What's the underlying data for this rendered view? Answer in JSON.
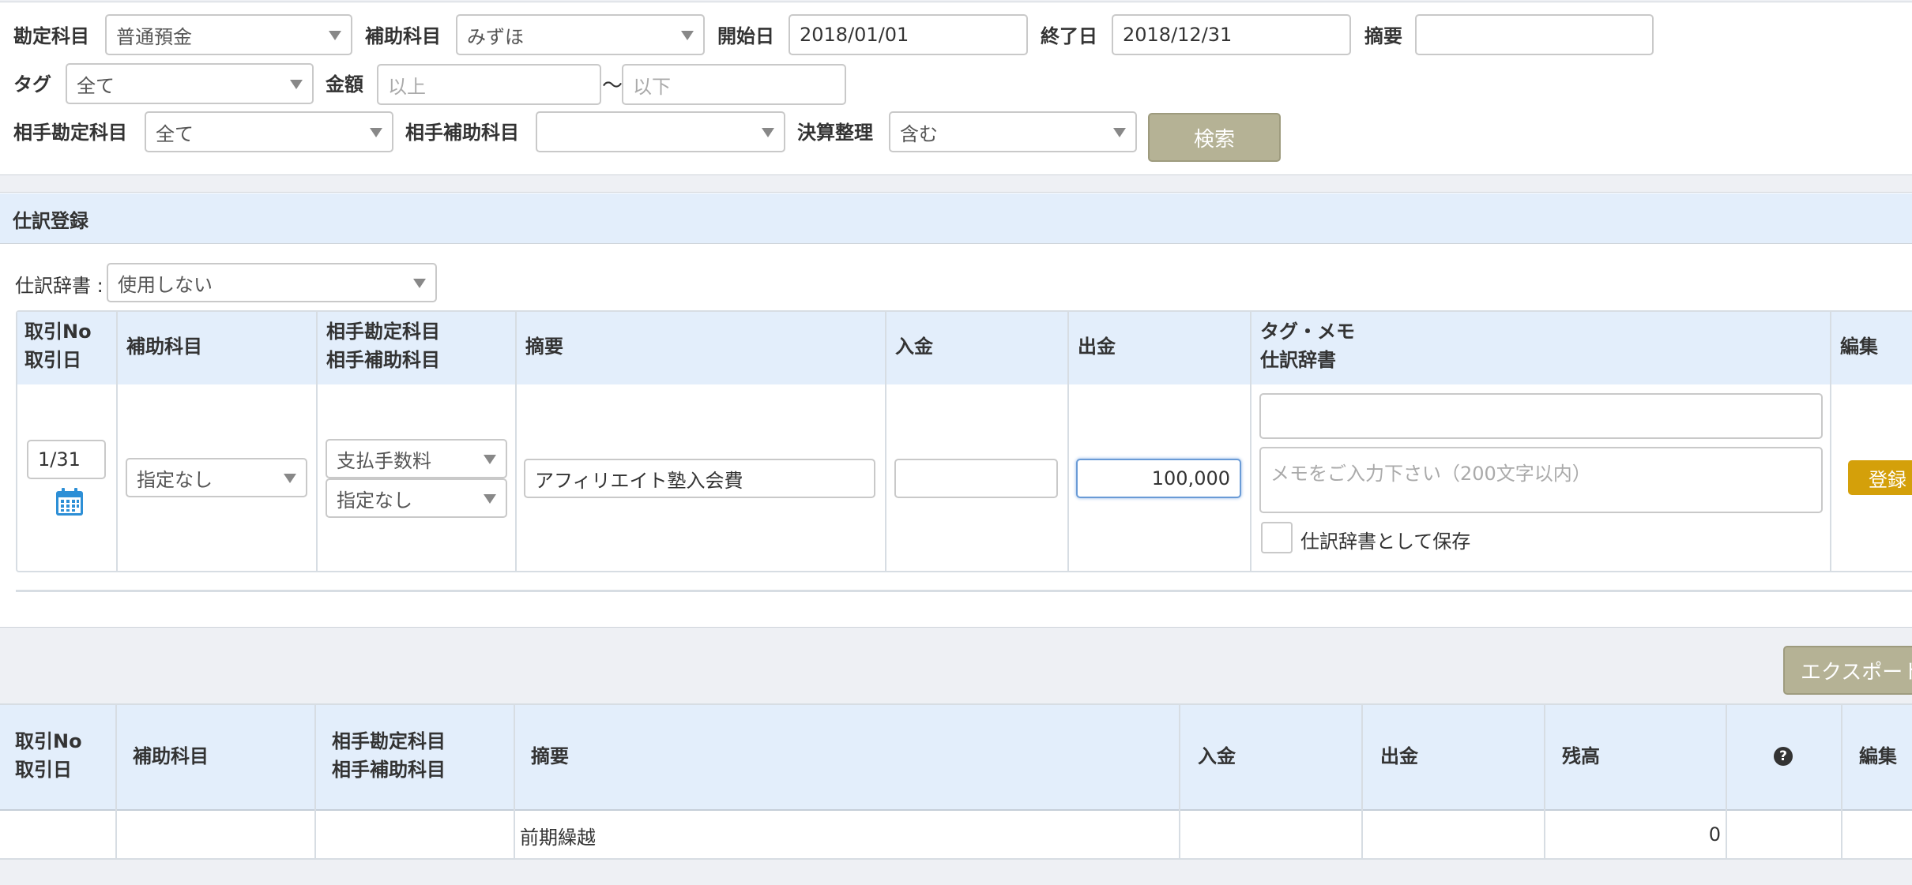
{
  "search": {
    "account_label": "勘定科目",
    "account_value": "普通預金",
    "sub_account_label": "補助科目",
    "sub_account_value": "みずほ",
    "start_label": "開始日",
    "start_value": "2018/01/01",
    "end_label": "終了日",
    "end_value": "2018/12/31",
    "memo_label": "摘要",
    "memo_value": "",
    "tag_label": "タグ",
    "tag_value": "全て",
    "amount_label": "金額",
    "amount_min_placeholder": "以上",
    "tilde": "〜",
    "amount_max_placeholder": "以下",
    "counter_account_label": "相手勘定科目",
    "counter_account_value": "全て",
    "counter_sub_label": "相手補助科目",
    "counter_sub_value": "",
    "closing_label": "決算整理",
    "closing_value": "含む",
    "search_button": "検索"
  },
  "entry": {
    "section_title": "仕訳登録",
    "dictionary_label": "仕訳辞書 :",
    "dictionary_value": "使用しない",
    "headers": {
      "no_line1": "取引No",
      "no_line2": "取引日",
      "sub_account": "補助科目",
      "counter_line1": "相手勘定科目",
      "counter_line2": "相手補助科目",
      "memo": "摘要",
      "deposit": "入金",
      "withdrawal": "出金",
      "tag_line1": "タグ・メモ",
      "tag_line2": "仕訳辞書",
      "edit": "編集"
    },
    "row": {
      "date": "1/31",
      "sub_account": "指定なし",
      "counter_account": "支払手数料",
      "counter_sub": "指定なし",
      "memo": "アフィリエイト塾入会費",
      "deposit": "",
      "withdrawal": "100,000",
      "tag": "",
      "note_placeholder": "メモをご入力下さい（200文字以内）",
      "save_dict_label": "仕訳辞書として保存",
      "register_button": "登録"
    }
  },
  "ledger": {
    "export_button": "エクスポート",
    "headers": {
      "no_line1": "取引No",
      "no_line2": "取引日",
      "sub_account": "補助科目",
      "counter_line1": "相手勘定科目",
      "counter_line2": "相手補助科目",
      "memo": "摘要",
      "deposit": "入金",
      "withdrawal": "出金",
      "balance": "残高",
      "help": "?",
      "edit": "編集"
    },
    "rows": [
      {
        "memo": "前期繰越",
        "balance": "0"
      }
    ]
  }
}
